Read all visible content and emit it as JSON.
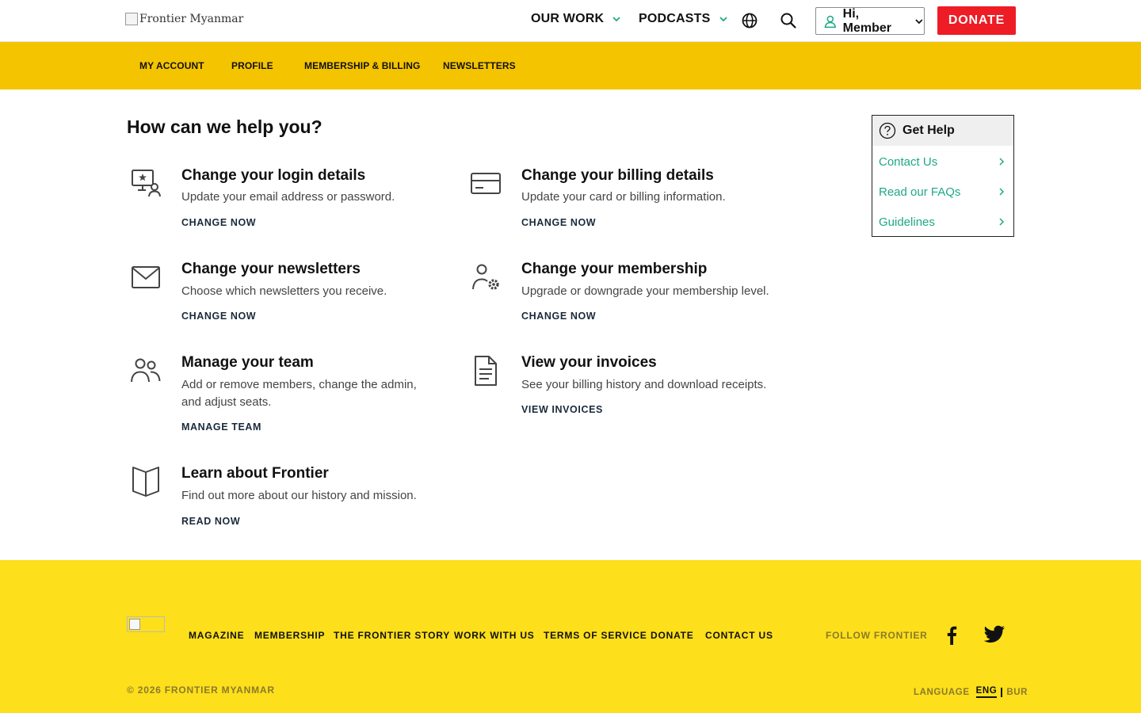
{
  "header": {
    "logo_alt": "Frontier Myanmar",
    "nav": [
      {
        "label": "OUR WORK"
      },
      {
        "label": "PODCASTS"
      }
    ],
    "member_label": "Hi, Member",
    "donate_label": "DONATE"
  },
  "subnav": {
    "items": [
      {
        "label": "MY ACCOUNT"
      },
      {
        "label": "PROFILE"
      },
      {
        "label": "MEMBERSHIP & BILLING"
      },
      {
        "label": "NEWSLETTERS"
      }
    ]
  },
  "main": {
    "title": "How can we help you?",
    "cards": [
      {
        "title": "Change your login details",
        "desc": "Update your email address or password.",
        "link": "CHANGE NOW",
        "icon": "monitor-user-icon"
      },
      {
        "title": "Change your billing details",
        "desc": "Update your card or billing information.",
        "link": "CHANGE NOW",
        "icon": "credit-card-icon"
      },
      {
        "title": "Change your newsletters",
        "desc": "Choose which newsletters you receive.",
        "link": "CHANGE NOW",
        "icon": "envelope-icon"
      },
      {
        "title": "Change your membership",
        "desc": "Upgrade or downgrade your membership level.",
        "link": "CHANGE NOW",
        "icon": "user-gear-icon"
      },
      {
        "title": "Manage your team",
        "desc": "Add or remove members, change the admin, and adjust seats.",
        "link": "MANAGE TEAM",
        "icon": "users-icon"
      },
      {
        "title": "View your invoices",
        "desc": "See your billing history and download receipts.",
        "link": "VIEW INVOICES",
        "icon": "document-icon"
      },
      {
        "title": "Learn about Frontier",
        "desc": "Find out more about our history and mission.",
        "link": "READ NOW",
        "icon": "book-icon"
      }
    ]
  },
  "help": {
    "title": "Get Help",
    "items": [
      {
        "label": "Contact Us"
      },
      {
        "label": "Read our FAQs"
      },
      {
        "label": "Guidelines"
      }
    ]
  },
  "footer": {
    "links": [
      {
        "label": "MAGAZINE"
      },
      {
        "label": "MEMBERSHIP"
      },
      {
        "label": "THE FRONTIER STORY"
      },
      {
        "label": "WORK WITH US"
      },
      {
        "label": "TERMS OF SERVICE"
      },
      {
        "label": "DONATE"
      },
      {
        "label": "CONTACT US"
      }
    ],
    "follow_label": "FOLLOW FRONTIER",
    "copyright": "© 2026 FRONTIER MYANMAR",
    "language_label": "LANGUAGE",
    "lang_eng": "ENG",
    "lang_bur": "BUR"
  },
  "colors": {
    "subnav_bg": "#f5c400",
    "footer_bg": "#fddf1b",
    "donate_bg": "#ee1c25",
    "help_link": "#1ea885",
    "chevron_accent": "#1ea885"
  }
}
